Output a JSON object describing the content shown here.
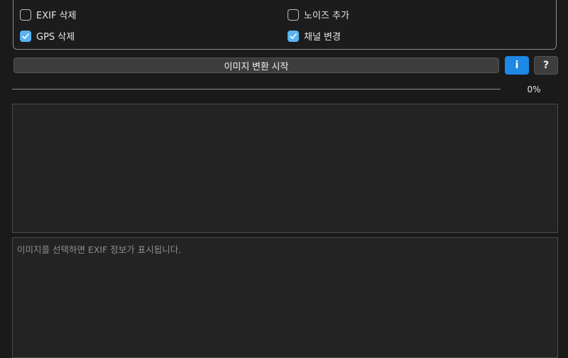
{
  "options": {
    "exif_remove": {
      "label": "EXIF 삭제",
      "checked": false
    },
    "add_noise": {
      "label": "노이즈 추가",
      "checked": false
    },
    "gps_remove": {
      "label": "GPS 삭제",
      "checked": true
    },
    "change_channel": {
      "label": "채널 변경",
      "checked": true
    }
  },
  "actions": {
    "start_label": "이미지 변환 시작",
    "info_label": "i",
    "help_label": "?"
  },
  "progress": {
    "value": 0,
    "text": "0%"
  },
  "exif": {
    "placeholder": "이미지를 선택하면 EXIF 정보가 표시됩니다."
  },
  "colors": {
    "accent": "#1e88e5",
    "checkbox_checked": "#5ab3f2"
  }
}
